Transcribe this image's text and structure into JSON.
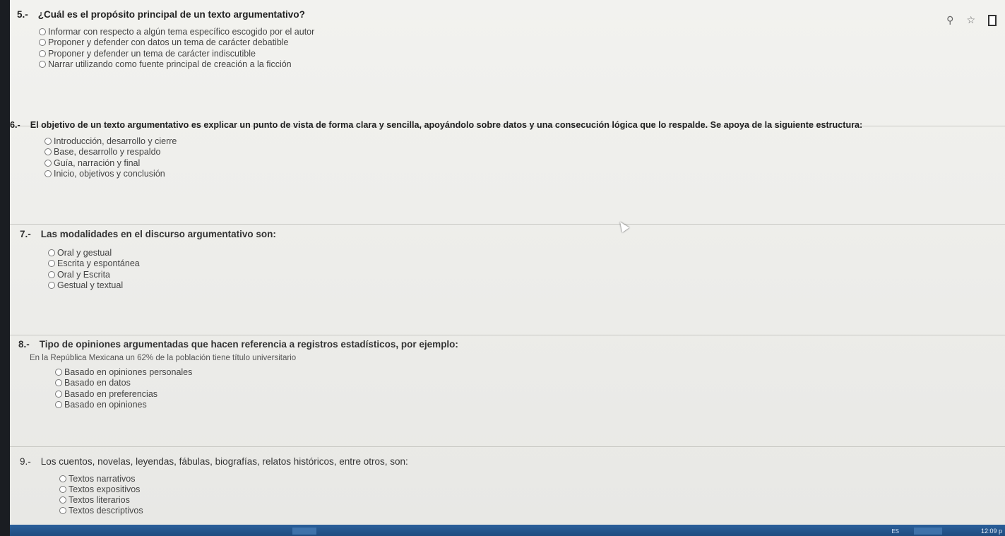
{
  "questions": [
    {
      "number": "5.-",
      "title": "¿Cuál es el propósito principal de un texto argumentativo?",
      "subtitle": "",
      "options": [
        "Informar con respecto a algún tema específico escogido por el autor",
        "Proponer y defender con datos un tema de carácter debatible",
        "Proponer y defender un tema de carácter indiscutible",
        "Narrar utilizando como fuente principal de creación a la ficción"
      ]
    },
    {
      "number": "6.-",
      "title": "El objetivo de un texto argumentativo es explicar un punto de vista de forma clara y sencilla, apoyándolo sobre datos y una consecución lógica que lo respalde. Se apoya de la siguiente estructura:",
      "subtitle": "",
      "options": [
        "Introducción, desarrollo y cierre",
        "Base, desarrollo y respaldo",
        "Guía, narración y final",
        "Inicio, objetivos y conclusión"
      ]
    },
    {
      "number": "7.-",
      "title": "Las modalidades en el discurso argumentativo son:",
      "subtitle": "",
      "options": [
        "Oral y gestual",
        "Escrita y espontánea",
        "Oral y Escrita",
        "Gestual y textual"
      ]
    },
    {
      "number": "8.-",
      "title": "Tipo de opiniones argumentadas que hacen referencia a registros estadísticos, por ejemplo:",
      "subtitle": "En la República Mexicana un 62% de la población tiene título universitario",
      "options": [
        "Basado en opiniones personales",
        "Basado en datos",
        "Basado en preferencias",
        "Basado en opiniones"
      ]
    },
    {
      "number": "9.-",
      "title": "Los cuentos, novelas, leyendas, fábulas, biografías, relatos históricos, entre otros, son:",
      "subtitle": "",
      "options": [
        "Textos narrativos",
        "Textos expositivos",
        "Textos literarios",
        "Textos descriptivos"
      ]
    }
  ],
  "browser": {
    "icons": [
      "search-icon",
      "star-icon",
      "extension-icon"
    ]
  },
  "taskbar": {
    "language": "ES",
    "clock": "12:09 p"
  },
  "colors": {
    "page_background": "#eeeeeb",
    "taskbar": "#1f4c80",
    "divider": "#c9c9c4"
  }
}
